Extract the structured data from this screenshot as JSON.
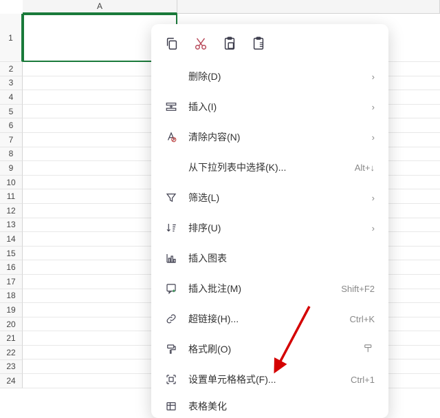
{
  "columns": [
    "A"
  ],
  "rows_first": "1",
  "rows": [
    "2",
    "3",
    "4",
    "5",
    "6",
    "7",
    "8",
    "9",
    "10",
    "11",
    "12",
    "13",
    "14",
    "15",
    "16",
    "17",
    "18",
    "19",
    "20",
    "21",
    "22",
    "23",
    "24"
  ],
  "toolbar": {
    "copy": "copy-icon",
    "cut": "cut-icon",
    "paste": "paste-icon",
    "paste_special": "paste-special-icon"
  },
  "menu": {
    "delete": "删除(D)",
    "insert": "插入(I)",
    "clear": "清除内容(N)",
    "dropdown_select": "从下拉列表中选择(K)...",
    "dropdown_select_shortcut": "Alt+↓",
    "filter": "筛选(L)",
    "sort": "排序(U)",
    "insert_chart": "插入图表",
    "insert_comment": "插入批注(M)",
    "insert_comment_shortcut": "Shift+F2",
    "hyperlink": "超链接(H)...",
    "hyperlink_shortcut": "Ctrl+K",
    "format_painter": "格式刷(O)",
    "cell_format": "设置单元格格式(F)...",
    "cell_format_shortcut": "Ctrl+1",
    "table_beautify": "表格美化"
  }
}
